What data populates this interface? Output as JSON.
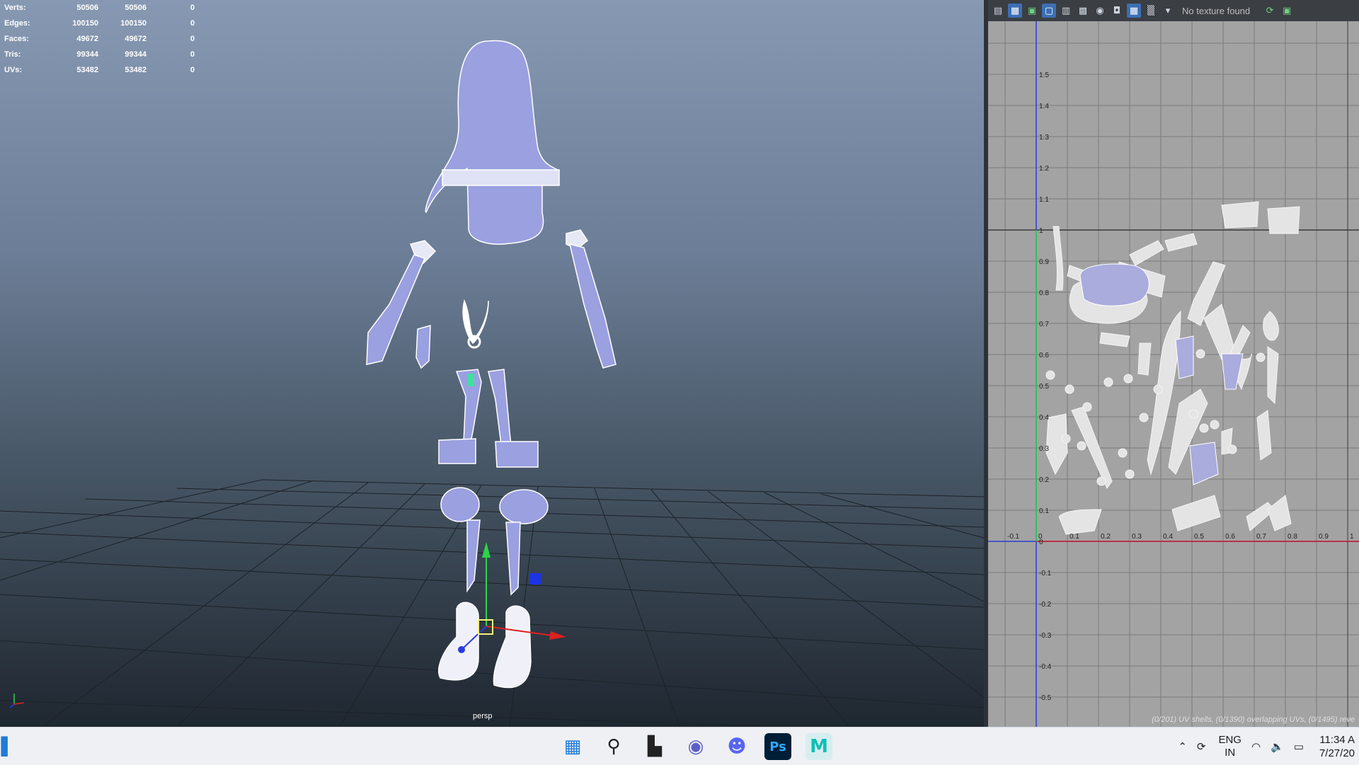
{
  "hud": {
    "rows": [
      {
        "label": "Verts:",
        "v1": "50506",
        "v2": "50506",
        "v3": "0"
      },
      {
        "label": "Edges:",
        "v1": "100150",
        "v2": "100150",
        "v3": "0"
      },
      {
        "label": "Faces:",
        "v1": "49672",
        "v2": "49672",
        "v3": "0"
      },
      {
        "label": "Tris:",
        "v1": "99344",
        "v2": "99344",
        "v3": "0"
      },
      {
        "label": "UVs:",
        "v1": "53482",
        "v2": "53482",
        "v3": "0"
      }
    ]
  },
  "viewport": {
    "camera_label": "persp"
  },
  "uv_editor": {
    "toolbar_icons": [
      "uv-grid-icon",
      "uv-display-icon",
      "uv-image-icon",
      "uv-frame-icon",
      "uv-snap-icon",
      "uv-checker-icon",
      "uv-shade-icon",
      "uv-camera-icon",
      "uv-texture-icon",
      "uv-pattern-icon",
      "dropdown-arrow-icon",
      "uv-sync-icon",
      "uv-export-icon"
    ],
    "texture_status": "No texture found",
    "v_ticks": [
      "1.5",
      "1.4",
      "1.3",
      "1.2",
      "1.1",
      "1",
      "0.9",
      "0.8",
      "0.7",
      "0.6",
      "0.5",
      "0.4",
      "0.3",
      "0.2",
      "0.1",
      "0",
      "-0.1",
      "-0.2",
      "-0.3",
      "-0.4",
      "-0.5"
    ],
    "u_ticks": [
      "-0.1",
      "0",
      "0.1",
      "0.2",
      "0.3",
      "0.4",
      "0.5",
      "0.6",
      "0.7",
      "0.8",
      "0.9",
      "1"
    ],
    "status_text": "(0/201) UV shells, (0/1390) overlapping UVs, (0/1495) reve",
    "axis_colors": {
      "u": "#d02020",
      "v": "#2b3fd0",
      "grid": "#7b7b7b"
    }
  },
  "taskbar": {
    "icons": [
      {
        "name": "windows-start-icon",
        "glyph": "▦",
        "color": "#1f7ad8"
      },
      {
        "name": "search-icon",
        "glyph": "⚲",
        "color": "#222"
      },
      {
        "name": "task-view-icon",
        "glyph": "▙",
        "color": "#222"
      },
      {
        "name": "teams-chat-icon",
        "glyph": "◉",
        "color": "#5b5fc7"
      },
      {
        "name": "discord-icon",
        "glyph": "☻",
        "color": "#5865f2"
      },
      {
        "name": "photoshop-icon",
        "glyph": "Ps",
        "color": "#31a8ff"
      },
      {
        "name": "maya-icon",
        "glyph": "M",
        "color": "#10bfb6"
      }
    ],
    "language": {
      "line1": "ENG",
      "line2": "IN"
    },
    "time": "11:34 A",
    "date": "7/27/20"
  }
}
